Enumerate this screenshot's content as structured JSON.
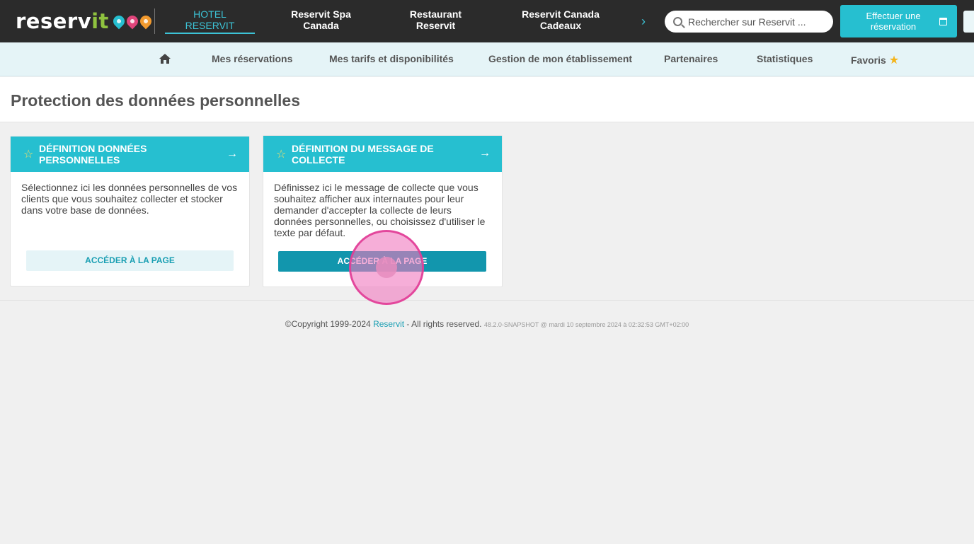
{
  "topbar": {
    "logo_text_main": "reserv",
    "logo_text_accent": "it",
    "nav": [
      {
        "line1": "HOTEL",
        "line2": "RESERVIT"
      },
      {
        "line1": "Reservit Spa",
        "line2": "Canada"
      },
      {
        "line1": "Restaurant",
        "line2": "Reservit"
      },
      {
        "line1": "Reservit Canada",
        "line2": "Cadeaux"
      }
    ],
    "search_placeholder": "Rechercher sur Reservit ...",
    "book_line1": "Effectuer une",
    "book_line2": "réservation",
    "colors": {
      "accent": "#26bfd0",
      "pins": [
        "#26bfd0",
        "#e0457b",
        "#f29a2e"
      ]
    }
  },
  "subnav": {
    "items": [
      "Mes réservations",
      "Mes tarifs et disponibilités",
      "Gestion de mon établissement",
      "Partenaires",
      "Statistiques",
      "Favoris"
    ]
  },
  "page": {
    "title": "Protection des données personnelles"
  },
  "cards": [
    {
      "title": "DÉFINITION DONNÉES PERSONNELLES",
      "description": "Sélectionnez ici les données personnelles de vos clients que vous souhaitez collecter et stocker dans votre base de données.",
      "button": "ACCÉDER À LA PAGE"
    },
    {
      "title": "DÉFINITION DU MESSAGE DE COLLECTE",
      "description": "Définissez ici le message de collecte que vous souhaitez afficher aux internautes pour leur demander d'accepter la collecte de leurs données personnelles, ou choisissez d'utiliser le texte par défaut.",
      "button": "ACCÉDER À LA PAGE"
    }
  ],
  "footer": {
    "copyright": "©Copyright 1999-2024",
    "brand": "Reservit",
    "rights": "- All rights reserved.",
    "version": "48.2.0-SNAPSHOT @ mardi 10 septembre 2024 à 02:32:53 GMT+02:00"
  }
}
